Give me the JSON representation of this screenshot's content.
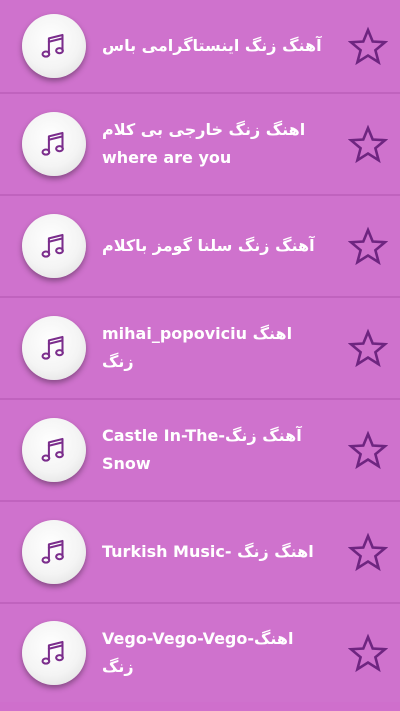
{
  "colors": {
    "background": "#cf72cd",
    "accent": "#7b2d8c",
    "text": "#ffffff"
  },
  "items": [
    {
      "title": "آهنگ زنگ اینستاگرامی باس",
      "icon": "music-note-icon",
      "favorite_icon": "star-outline-icon"
    },
    {
      "title": "اهنگ زنگ خارجی بی کلام\nwhere are you",
      "icon": "music-note-icon",
      "favorite_icon": "star-outline-icon"
    },
    {
      "title": "آهنگ زنگ سلنا  گومز باکلام",
      "icon": "music-note-icon",
      "favorite_icon": "star-outline-icon"
    },
    {
      "title": "mihai_popoviciu اهنگ زنگ",
      "icon": "music-note-icon",
      "favorite_icon": "star-outline-icon"
    },
    {
      "title": "Castle In-The-آهنگ زنگ\n Snow",
      "icon": "music-note-icon",
      "favorite_icon": "star-outline-icon"
    },
    {
      "title": "Turkish Music- اهنگ زنگ",
      "icon": "music-note-icon",
      "favorite_icon": "star-outline-icon"
    },
    {
      "title": "Vego-Vego-Vego-اهنگ زنگ",
      "icon": "music-note-icon",
      "favorite_icon": "star-outline-icon"
    }
  ]
}
